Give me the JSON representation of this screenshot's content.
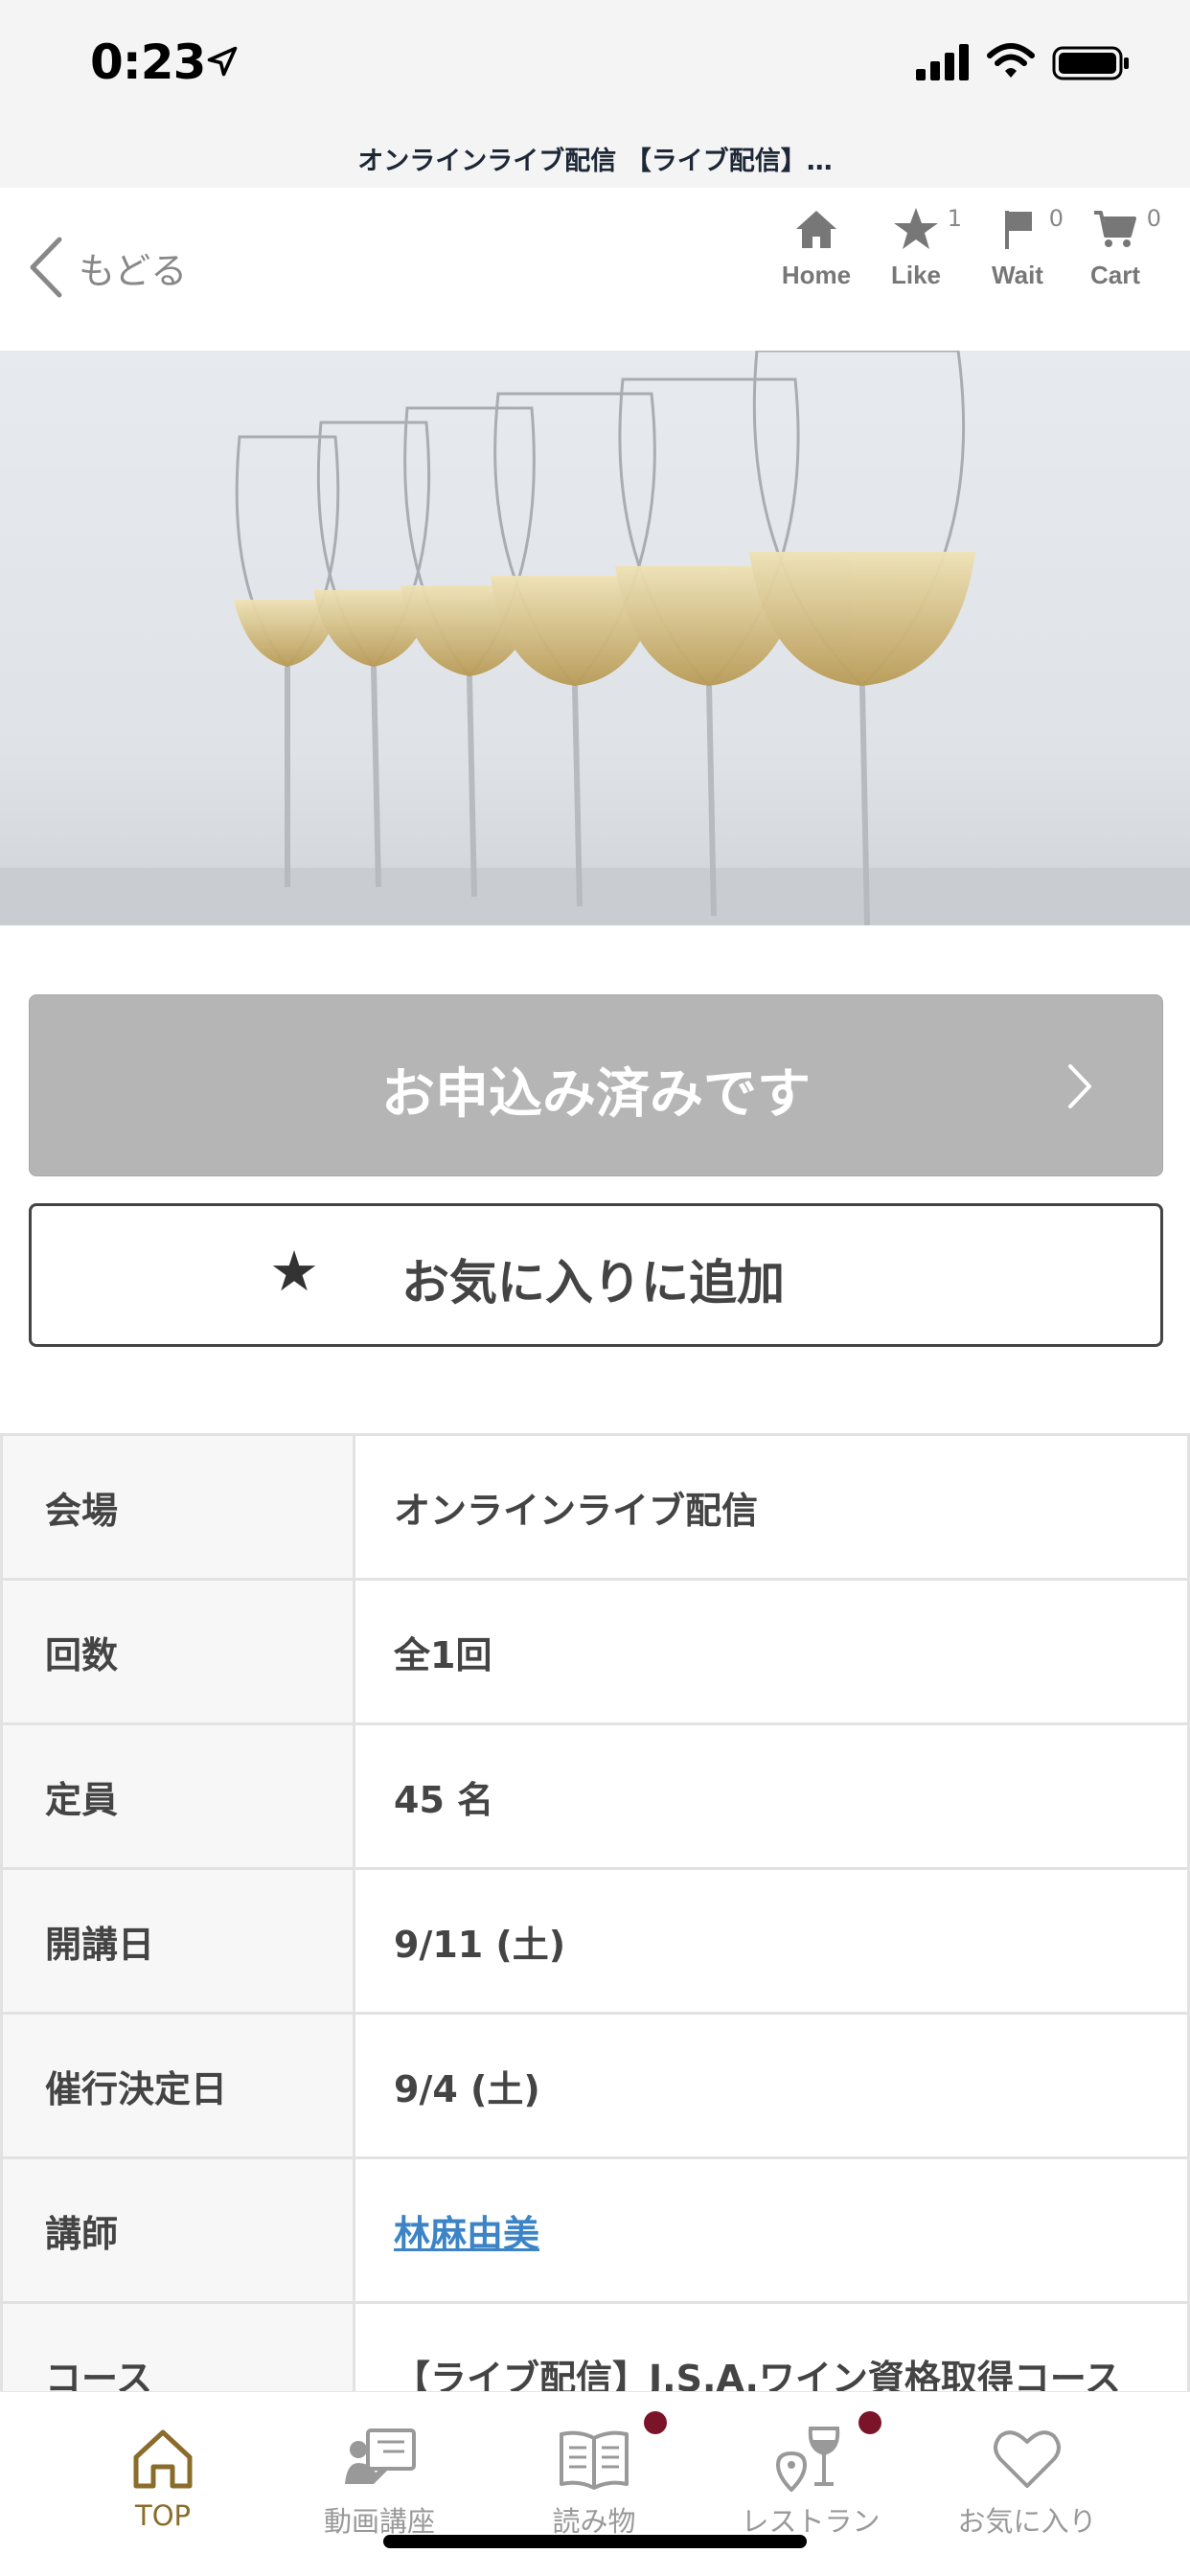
{
  "status_bar": {
    "time": "0:23",
    "icons": [
      "location-arrow-icon",
      "signal-bars-icon",
      "wifi-icon",
      "battery-icon"
    ]
  },
  "url_bar": {
    "title": "オンラインライブ配信 【ライブ配信】…"
  },
  "header": {
    "back_label": "もどる",
    "nav": [
      {
        "label": "Home",
        "icon": "home-icon"
      },
      {
        "label": "Like",
        "icon": "star-icon",
        "count": "1"
      },
      {
        "label": "Wait",
        "icon": "flag-icon",
        "count": "0"
      },
      {
        "label": "Cart",
        "icon": "cart-icon",
        "count": "0"
      }
    ]
  },
  "hero": {
    "alt": "wine glasses"
  },
  "actions": {
    "apply_label": "お申込み済みです",
    "favorite_star": "★",
    "favorite_label": "お気に入りに追加"
  },
  "details": [
    {
      "key": "会場",
      "value": "オンラインライブ配信"
    },
    {
      "key": "回数",
      "value": "全1回"
    },
    {
      "key": "定員",
      "value": "45 名"
    },
    {
      "key": "開講日",
      "value": "9/11 (土)"
    },
    {
      "key": "催行決定日",
      "value": "9/4 (土)"
    },
    {
      "key": "講師",
      "value": "林麻由美"
    },
    {
      "key": "コース",
      "value": "【ライブ配信】J.S.A.ワイン資格取得コース"
    }
  ],
  "tab_bar": {
    "tabs": [
      {
        "label": "TOP",
        "icon": "home-icon",
        "active": true
      },
      {
        "label": "動画講座",
        "icon": "video-lesson-icon"
      },
      {
        "label": "読み物",
        "icon": "book-icon",
        "badge": true
      },
      {
        "label": "レストラン",
        "icon": "restaurant-wine-icon",
        "badge": true
      },
      {
        "label": "お気に入り",
        "icon": "heart-icon"
      }
    ]
  },
  "colors": {
    "accent_gold": "#8a6d2b",
    "badge_red": "#7b1428",
    "link_blue": "#3c84c6",
    "disabled_button": "#b5b5b5"
  }
}
